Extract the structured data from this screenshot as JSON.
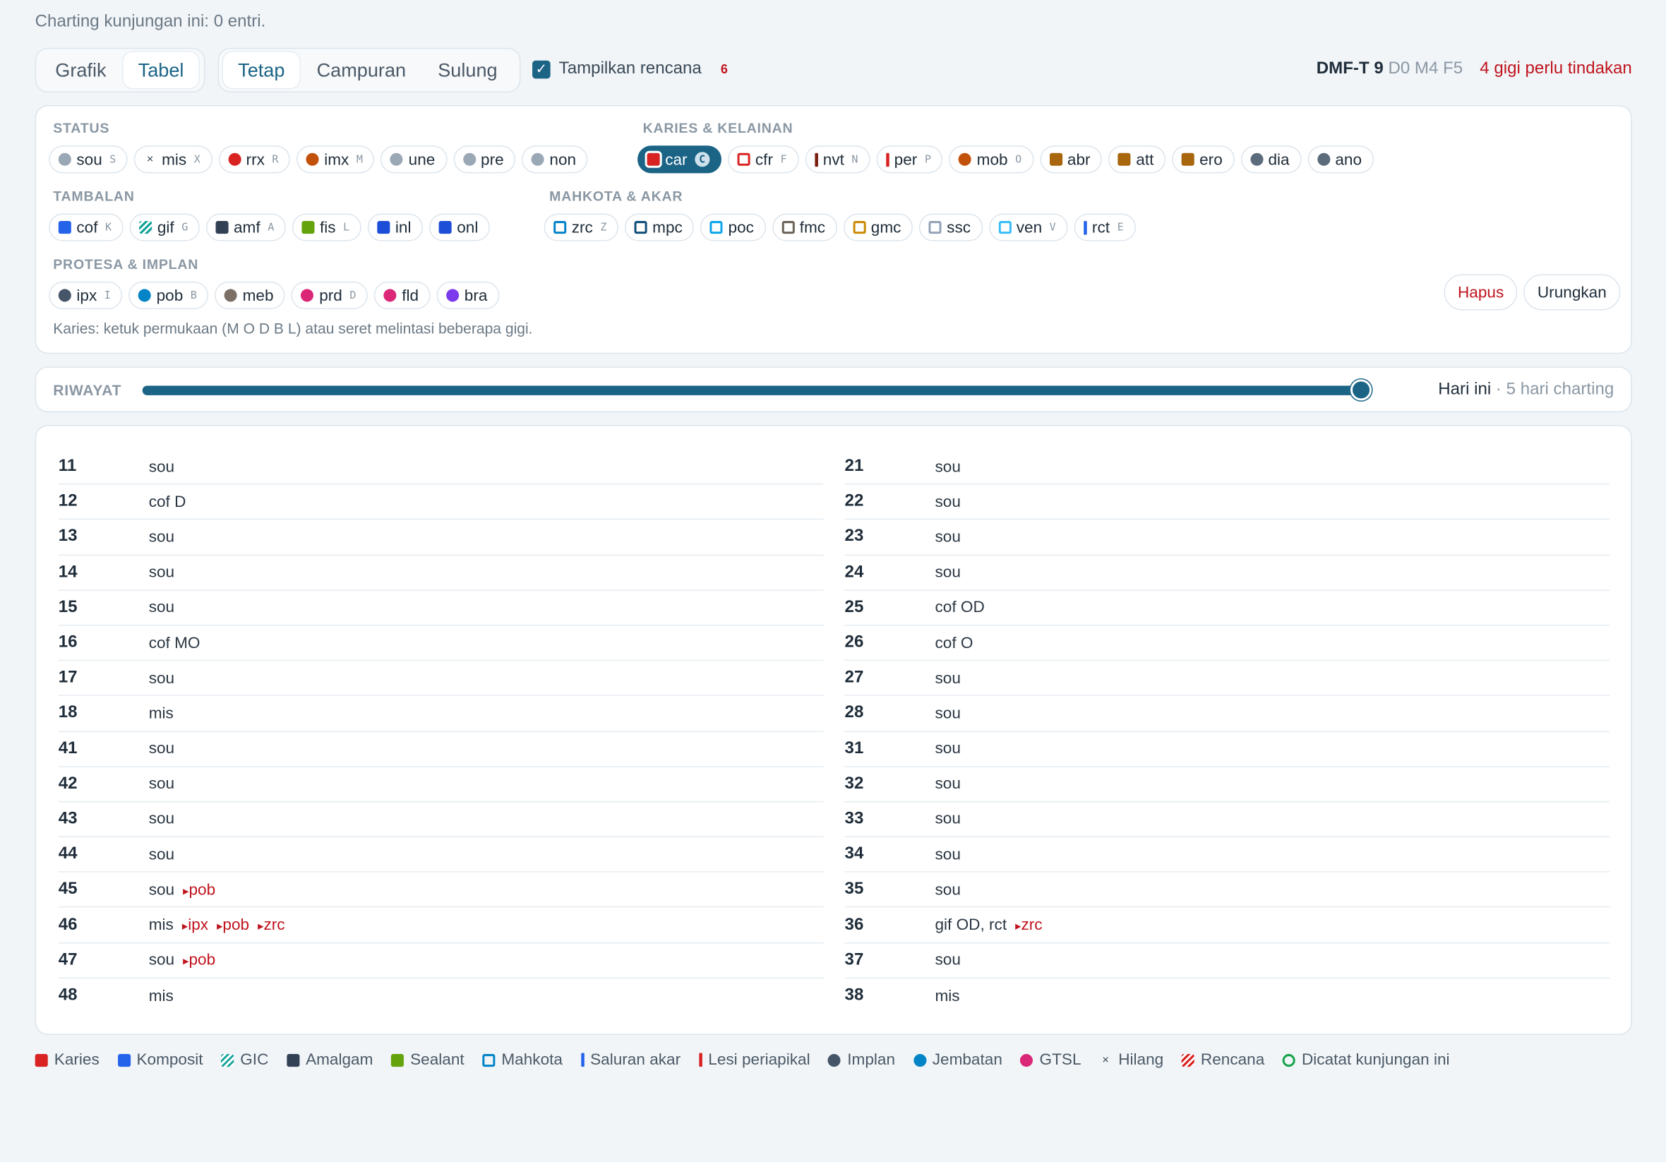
{
  "header": {
    "subtitle": "Charting kunjungan ini: 0 entri.",
    "view_tabs": [
      {
        "label": "Grafik",
        "active": false
      },
      {
        "label": "Tabel",
        "active": true
      }
    ],
    "dentition_tabs": [
      {
        "label": "Tetap",
        "active": true
      },
      {
        "label": "Campuran",
        "active": false
      },
      {
        "label": "Sulung",
        "active": false
      }
    ],
    "show_plan": {
      "label": "Tampilkan rencana",
      "checked": true,
      "count": "6"
    },
    "dmf": {
      "code": "DMF-T 9",
      "detail": "D0 M4 F5"
    },
    "alert": "4 gigi perlu tindakan"
  },
  "palette": {
    "groups": {
      "status": "STATUS",
      "caries": "KARIES & KELAINAN",
      "fillings": "TAMBALAN",
      "crowns": "MAHKOTA & AKAR",
      "prosthesis": "PROTESA & IMPLAN"
    },
    "status": [
      {
        "label": "sou",
        "key": "S",
        "color": "#9aa7b4",
        "shape": "dot"
      },
      {
        "label": "mis",
        "key": "X",
        "color": "#3b4a57",
        "shape": "cross"
      },
      {
        "label": "rrx",
        "key": "R",
        "color": "#d92323",
        "shape": "dot"
      },
      {
        "label": "imx",
        "key": "M",
        "color": "#c2510c",
        "shape": "dot"
      },
      {
        "label": "une",
        "key": "",
        "color": "#9aa7b4",
        "shape": "dot"
      },
      {
        "label": "pre",
        "key": "",
        "color": "#9aa7b4",
        "shape": "dot"
      },
      {
        "label": "non",
        "key": "",
        "color": "#9aa7b4",
        "shape": "dot"
      }
    ],
    "caries": [
      {
        "label": "car",
        "key": "C",
        "color": "#d92323",
        "shape": "sq",
        "active": true
      },
      {
        "label": "cfr",
        "key": "F",
        "color": "#d92323",
        "shape": "ring"
      },
      {
        "label": "nvt",
        "key": "N",
        "color": "#7a1e12",
        "shape": "bar"
      },
      {
        "label": "per",
        "key": "P",
        "color": "#d92323",
        "shape": "bar"
      },
      {
        "label": "mob",
        "key": "O",
        "color": "#c2510c",
        "shape": "dot"
      },
      {
        "label": "abr",
        "key": "",
        "color": "#a8660f",
        "shape": "sq"
      },
      {
        "label": "att",
        "key": "",
        "color": "#a8660f",
        "shape": "sq"
      },
      {
        "label": "ero",
        "key": "",
        "color": "#a8660f",
        "shape": "sq"
      },
      {
        "label": "dia",
        "key": "",
        "color": "#5b6b7c",
        "shape": "dot"
      },
      {
        "label": "ano",
        "key": "",
        "color": "#5b6b7c",
        "shape": "dot"
      }
    ],
    "fillings": [
      {
        "label": "cof",
        "key": "K",
        "color": "#2563eb",
        "shape": "sq"
      },
      {
        "label": "gif",
        "key": "G",
        "color": "#14a39a",
        "shape": "stripe"
      },
      {
        "label": "amf",
        "key": "A",
        "color": "#334155",
        "shape": "sq"
      },
      {
        "label": "fis",
        "key": "L",
        "color": "#65a30d",
        "shape": "sq"
      },
      {
        "label": "inl",
        "key": "",
        "color": "#1d4ed8",
        "shape": "sq"
      },
      {
        "label": "onl",
        "key": "",
        "color": "#1d4ed8",
        "shape": "sq"
      }
    ],
    "crowns": [
      {
        "label": "zrc",
        "key": "Z",
        "color": "#0284c7",
        "shape": "ring"
      },
      {
        "label": "mpc",
        "key": "",
        "color": "#0f4f7a",
        "shape": "ring"
      },
      {
        "label": "poc",
        "key": "",
        "color": "#0ea5e9",
        "shape": "ring"
      },
      {
        "label": "fmc",
        "key": "",
        "color": "#6b6258",
        "shape": "ring"
      },
      {
        "label": "gmc",
        "key": "",
        "color": "#ca8a04",
        "shape": "ring"
      },
      {
        "label": "ssc",
        "key": "",
        "color": "#94a3b8",
        "shape": "ring"
      },
      {
        "label": "ven",
        "key": "V",
        "color": "#38bdf8",
        "shape": "ring"
      },
      {
        "label": "rct",
        "key": "E",
        "color": "#2563eb",
        "shape": "bar"
      }
    ],
    "prosthesis": [
      {
        "label": "ipx",
        "key": "I",
        "color": "#475569",
        "shape": "dot"
      },
      {
        "label": "pob",
        "key": "B",
        "color": "#0284c7",
        "shape": "dot"
      },
      {
        "label": "meb",
        "key": "",
        "color": "#7c6f66",
        "shape": "dot"
      },
      {
        "label": "prd",
        "key": "D",
        "color": "#db2777",
        "shape": "dot"
      },
      {
        "label": "fld",
        "key": "",
        "color": "#db2777",
        "shape": "dot"
      },
      {
        "label": "bra",
        "key": "",
        "color": "#7c3aed",
        "shape": "dot"
      }
    ],
    "hint": "Karies: ketuk permukaan (M O D B L) atau seret melintasi beberapa gigi.",
    "clear_label": "Hapus",
    "undo_label": "Urungkan"
  },
  "history": {
    "label": "RIWAYAT",
    "position": "Hari ini",
    "summary": "· 5 hari charting",
    "slider_fraction": 1.0
  },
  "table": {
    "left": [
      {
        "tooth": "11",
        "value": "sou",
        "plans": []
      },
      {
        "tooth": "12",
        "value": "cof D",
        "plans": []
      },
      {
        "tooth": "13",
        "value": "sou",
        "plans": []
      },
      {
        "tooth": "14",
        "value": "sou",
        "plans": []
      },
      {
        "tooth": "15",
        "value": "sou",
        "plans": []
      },
      {
        "tooth": "16",
        "value": "cof MO",
        "plans": []
      },
      {
        "tooth": "17",
        "value": "sou",
        "plans": []
      },
      {
        "tooth": "18",
        "value": "mis",
        "plans": []
      },
      {
        "tooth": "41",
        "value": "sou",
        "plans": []
      },
      {
        "tooth": "42",
        "value": "sou",
        "plans": []
      },
      {
        "tooth": "43",
        "value": "sou",
        "plans": []
      },
      {
        "tooth": "44",
        "value": "sou",
        "plans": []
      },
      {
        "tooth": "45",
        "value": "sou",
        "plans": [
          "pob"
        ]
      },
      {
        "tooth": "46",
        "value": "mis",
        "plans": [
          "ipx",
          "pob",
          "zrc"
        ]
      },
      {
        "tooth": "47",
        "value": "sou",
        "plans": [
          "pob"
        ]
      },
      {
        "tooth": "48",
        "value": "mis",
        "plans": []
      }
    ],
    "right": [
      {
        "tooth": "21",
        "value": "sou",
        "plans": []
      },
      {
        "tooth": "22",
        "value": "sou",
        "plans": []
      },
      {
        "tooth": "23",
        "value": "sou",
        "plans": []
      },
      {
        "tooth": "24",
        "value": "sou",
        "plans": []
      },
      {
        "tooth": "25",
        "value": "cof OD",
        "plans": []
      },
      {
        "tooth": "26",
        "value": "cof O",
        "plans": []
      },
      {
        "tooth": "27",
        "value": "sou",
        "plans": []
      },
      {
        "tooth": "28",
        "value": "sou",
        "plans": []
      },
      {
        "tooth": "31",
        "value": "sou",
        "plans": []
      },
      {
        "tooth": "32",
        "value": "sou",
        "plans": []
      },
      {
        "tooth": "33",
        "value": "sou",
        "plans": []
      },
      {
        "tooth": "34",
        "value": "sou",
        "plans": []
      },
      {
        "tooth": "35",
        "value": "sou",
        "plans": []
      },
      {
        "tooth": "36",
        "value": "gif OD, rct",
        "plans": [
          "zrc"
        ]
      },
      {
        "tooth": "37",
        "value": "sou",
        "plans": []
      },
      {
        "tooth": "38",
        "value": "mis",
        "plans": []
      }
    ]
  },
  "legend": [
    {
      "label": "Karies",
      "color": "#d92323",
      "shape": "sq"
    },
    {
      "label": "Komposit",
      "color": "#2563eb",
      "shape": "sq"
    },
    {
      "label": "GIC",
      "color": "#14a39a",
      "shape": "stripe"
    },
    {
      "label": "Amalgam",
      "color": "#334155",
      "shape": "sq"
    },
    {
      "label": "Sealant",
      "color": "#65a30d",
      "shape": "sq"
    },
    {
      "label": "Mahkota",
      "color": "#0284c7",
      "shape": "ring"
    },
    {
      "label": "Saluran akar",
      "color": "#2563eb",
      "shape": "bar"
    },
    {
      "label": "Lesi periapikal",
      "color": "#d92323",
      "shape": "bar"
    },
    {
      "label": "Implan",
      "color": "#475569",
      "shape": "dot"
    },
    {
      "label": "Jembatan",
      "color": "#0284c7",
      "shape": "dot"
    },
    {
      "label": "GTSL",
      "color": "#db2777",
      "shape": "dot"
    },
    {
      "label": "Hilang",
      "color": "#3b4a57",
      "shape": "cross"
    },
    {
      "label": "Rencana",
      "color": "#d92323",
      "shape": "hatch"
    },
    {
      "label": "Dicatat kunjungan ini",
      "color": "#16a34a",
      "shape": "circle"
    }
  ]
}
